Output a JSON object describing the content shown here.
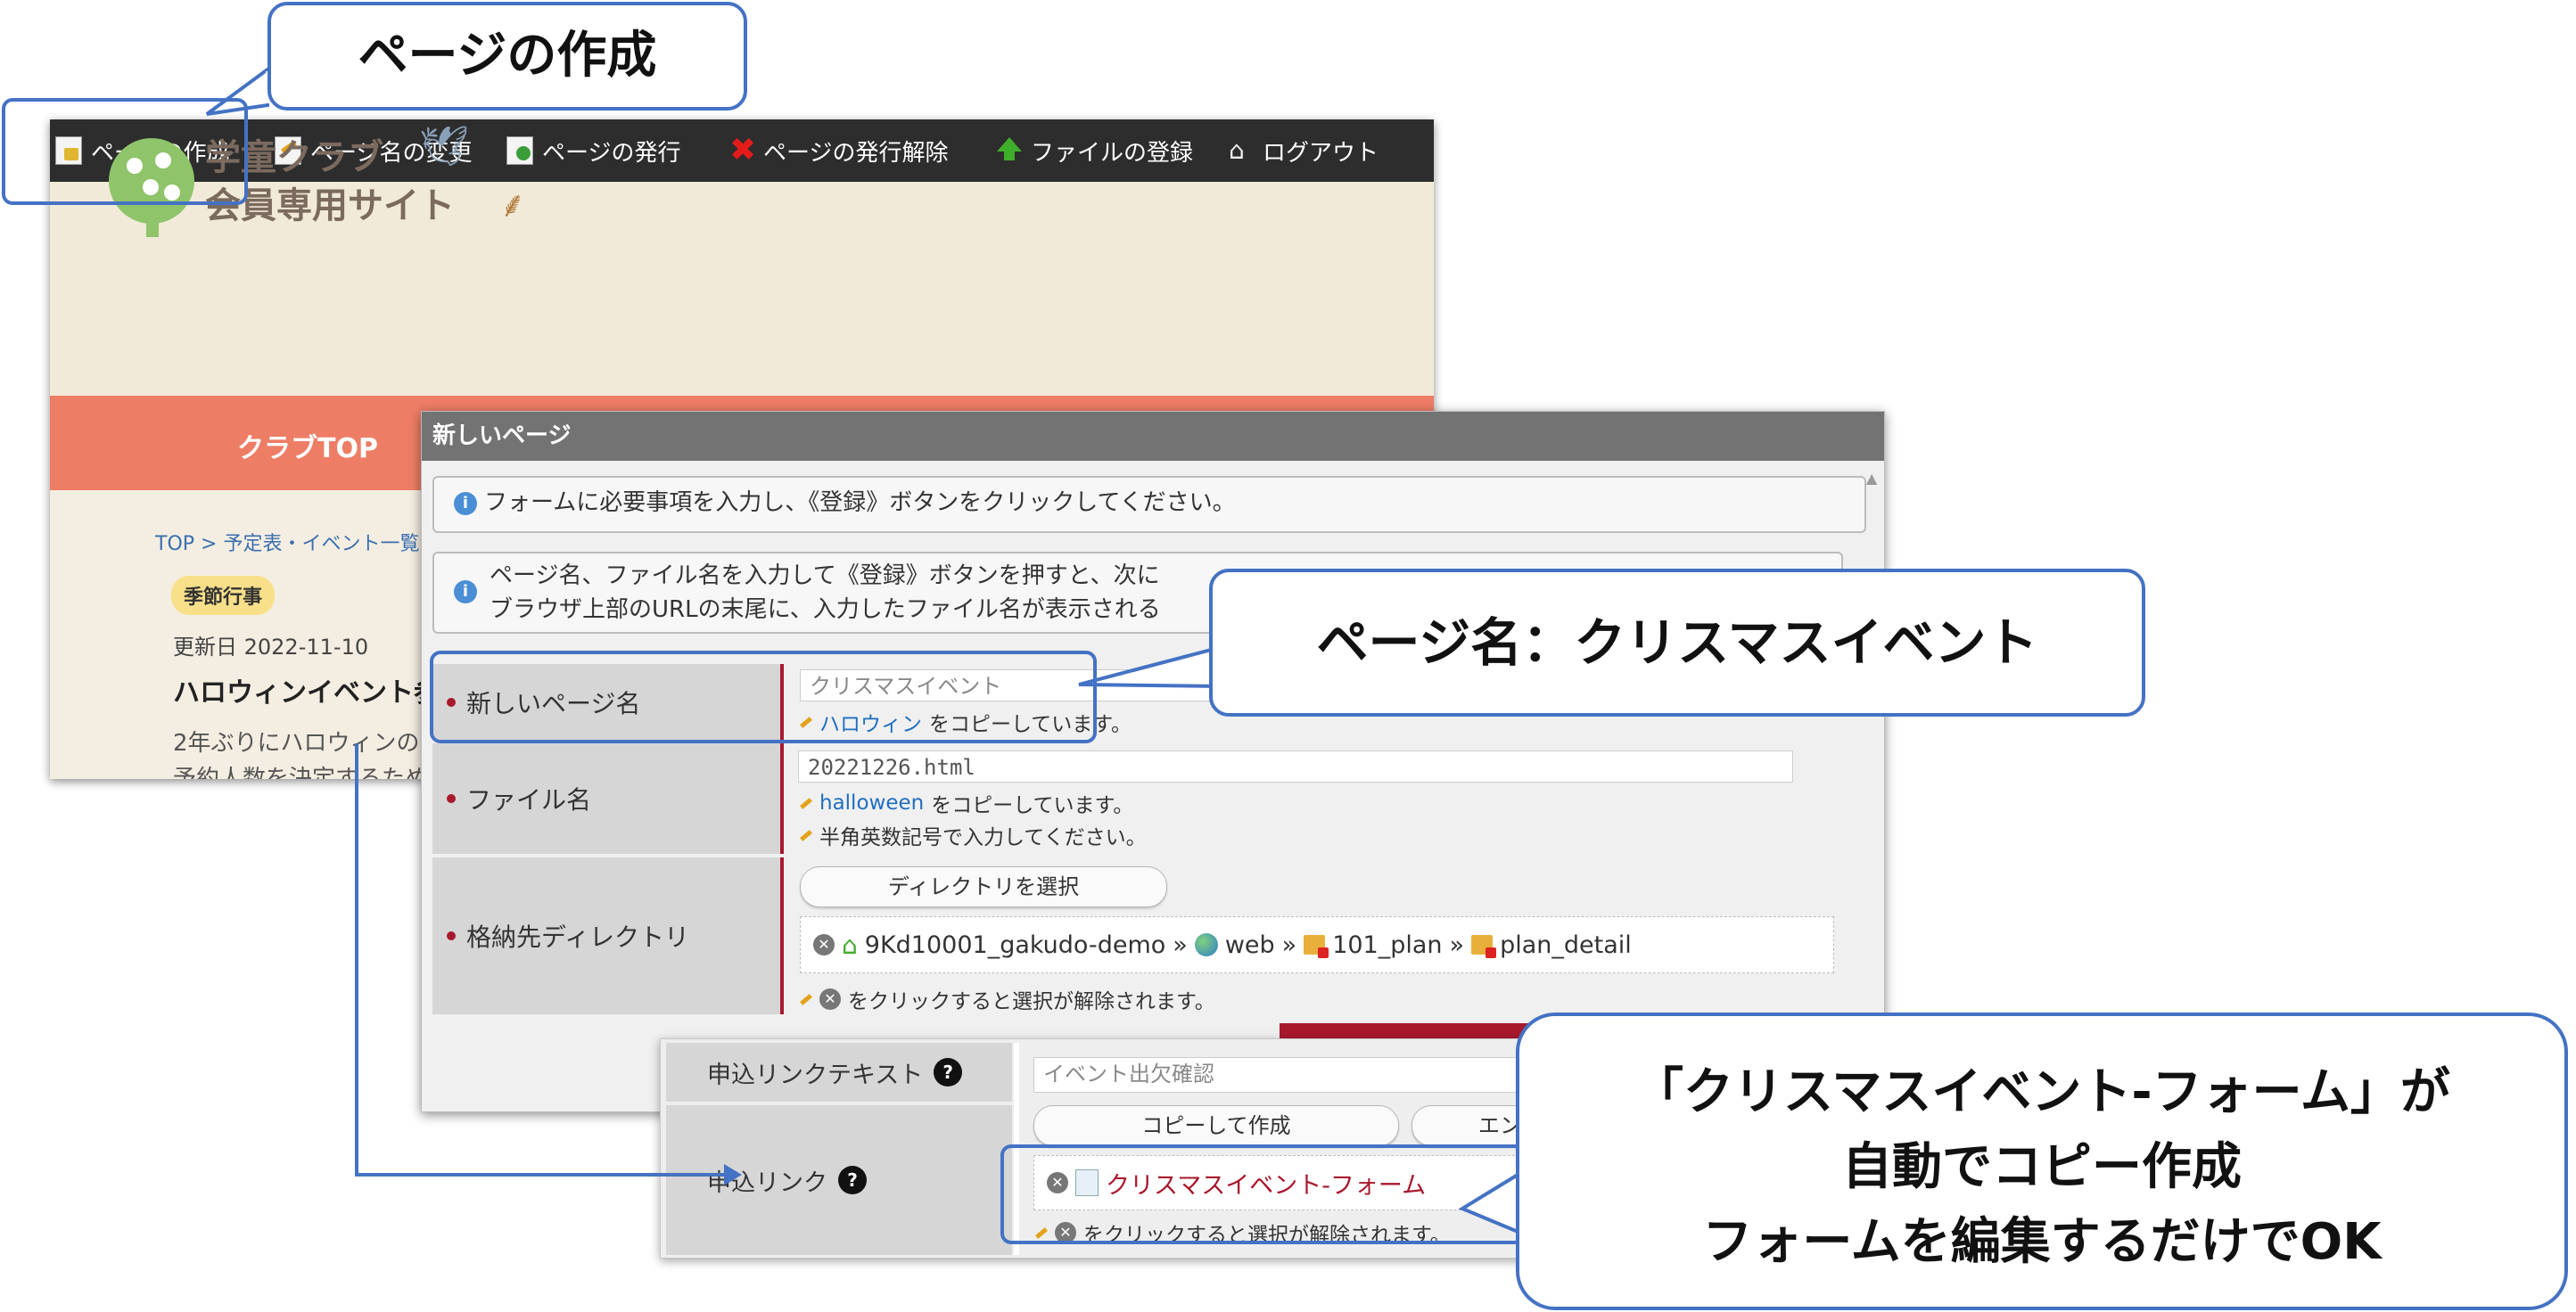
{
  "toolbar": {
    "items": [
      {
        "label": "ページの作成",
        "icon": "new-page-icon"
      },
      {
        "label": "ページ名の変更",
        "icon": "rename-icon"
      },
      {
        "label": "ページの発行",
        "icon": "publish-icon"
      },
      {
        "label": "ページの発行解除",
        "icon": "unpublish-icon"
      },
      {
        "label": "ファイルの登録",
        "icon": "upload-icon"
      },
      {
        "label": "ログアウト",
        "icon": "home-icon"
      }
    ]
  },
  "site": {
    "title_line1": "学童クラブ",
    "title_line2": "会員専用サイト",
    "nav_top": "クラブTOP",
    "breadcrumb": "TOP > 予定表・イベント一覧",
    "badge": "季節行事",
    "updated": "更新日 2022-11-10",
    "article_title": "ハロウィンイベント参",
    "article_body_line1": "2年ぶりにハロウィンの",
    "article_body_line2": "予約人数を決定するため"
  },
  "dialog": {
    "title": "新しいページ",
    "info1": "フォームに必要事項を入力し、《登録》ボタンをクリックしてください。",
    "info2_line1": "ページ名、ファイル名を入力して《登録》ボタンを押すと、次に",
    "info2_line2": "ブラウザ上部のURLの末尾に、入力したファイル名が表示される",
    "page_name": {
      "label": "新しいページ名",
      "value": "クリスマスイベント",
      "copy_link": "ハロウィン",
      "copy_note": "をコピーしています。"
    },
    "file_name": {
      "label": "ファイル名",
      "value": "20221226.html",
      "copy_link": "halloween",
      "copy_note": "をコピーしています。",
      "hint": "半角英数記号で入力してください。"
    },
    "directory": {
      "label": "格納先ディレクトリ",
      "select_button": "ディレクトリを選択",
      "path": [
        "9Kd10001_gakudo-demo",
        "web",
        "101_plan",
        "plan_detail"
      ],
      "separator": "»",
      "hint": "をクリックすると選択が解除されます。"
    }
  },
  "form_panel": {
    "link_text_label": "申込リンクテキスト",
    "link_text_value": "イベント出欠確認",
    "link_label": "申込リンク",
    "copy_create_button": "コピーして作成",
    "entry_button": "エント",
    "linked_form": "クリスマスイベント-フォーム",
    "hint": "をクリックすると選択が解除されます。"
  },
  "callouts": {
    "create_page": "ページの作成",
    "page_name": "ページ名：クリスマスイベント",
    "form_line1": "「クリスマスイベント-フォーム」が",
    "form_line2": "自動でコピー作成",
    "form_line3": "フォームを編集するだけでOK"
  },
  "colors": {
    "callout_border": "#4472c4",
    "toolbar_bg": "#2d2d2d",
    "nav_bg": "#ee7d66",
    "required_marker": "#a8192e",
    "dialog_title_bg": "#737373"
  }
}
